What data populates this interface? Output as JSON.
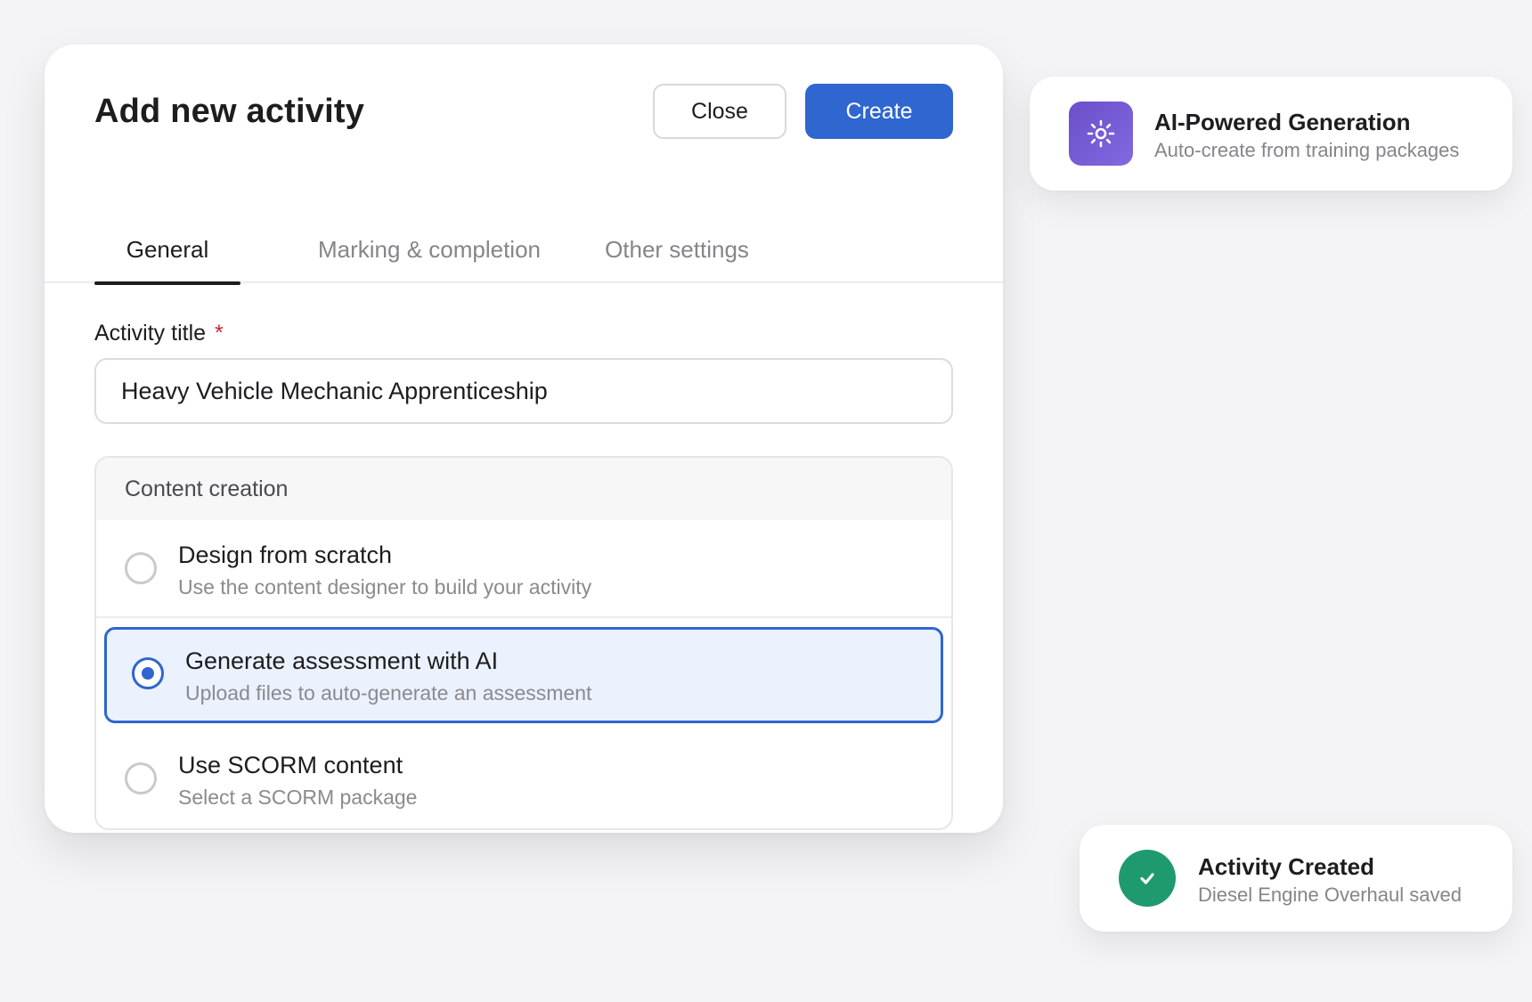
{
  "modal": {
    "title": "Add new activity",
    "close_label": "Close",
    "create_label": "Create",
    "tabs": [
      {
        "label": "General",
        "active": true
      },
      {
        "label": "Marking & completion",
        "active": false
      },
      {
        "label": "Other settings",
        "active": false
      }
    ],
    "activity_title": {
      "label": "Activity title",
      "required_marker": "*",
      "value": "Heavy Vehicle Mechanic Apprenticeship"
    },
    "content_creation": {
      "header": "Content creation",
      "selected_index": 1,
      "options": [
        {
          "title": "Design from scratch",
          "subtitle": "Use the content designer to build your activity"
        },
        {
          "title": "Generate assessment with AI",
          "subtitle": "Upload files to auto-generate an assessment"
        },
        {
          "title": "Use SCORM content",
          "subtitle": "Select a SCORM package"
        }
      ]
    }
  },
  "ai_card": {
    "title": "AI-Powered Generation",
    "subtitle": "Auto-create from training packages",
    "icon": "sparkle-icon"
  },
  "toast": {
    "title": "Activity Created",
    "subtitle": "Diesel Engine Overhaul saved",
    "icon": "check-icon"
  },
  "colors": {
    "primary": "#2f66cf",
    "selected_bg": "#ebf1fd",
    "ai_purple": "#6a4fc9",
    "success_green": "#1f9a6f",
    "required_red": "#c62828"
  }
}
